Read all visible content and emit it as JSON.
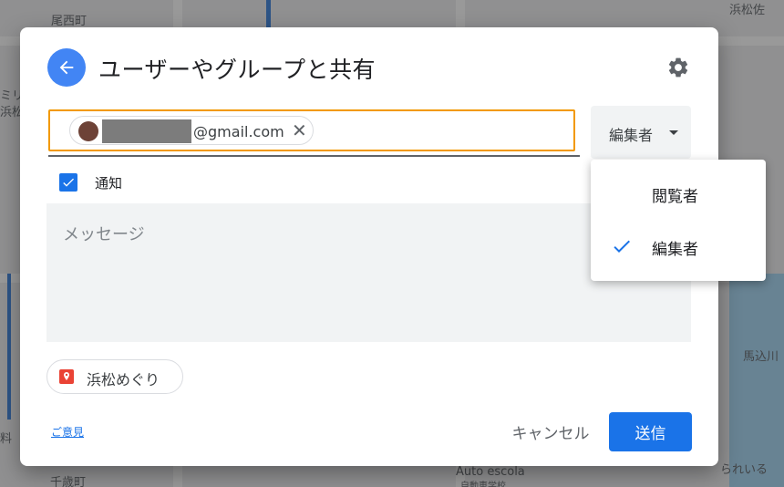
{
  "map_labels": [
    "浜松佐",
    "尾西町",
    "ミリ",
    "浜松",
    "千歳町",
    "Auto escola",
    "自動車学校",
    "馬込川",
    "られいる",
    "料"
  ],
  "dialog": {
    "title": "ユーザーやグループと共有",
    "recipient": {
      "email_suffix": "@gmail.com",
      "remove_symbol": "✕"
    },
    "role_button": {
      "label": "編集者"
    },
    "notify": {
      "label": "通知",
      "checked": true
    },
    "message": {
      "placeholder": "メッセージ"
    },
    "map_chip": {
      "label": "浜松めぐり"
    },
    "feedback_link": "ご意見",
    "cancel_label": "キャンセル",
    "send_label": "送信"
  },
  "role_dropdown": {
    "items": [
      {
        "label": "閲覧者",
        "selected": false
      },
      {
        "label": "編集者",
        "selected": true
      }
    ]
  },
  "colors": {
    "accent": "#1a73e8",
    "back_button": "#4285f4",
    "focus_border": "#f29900",
    "pin": "#ea4335"
  }
}
